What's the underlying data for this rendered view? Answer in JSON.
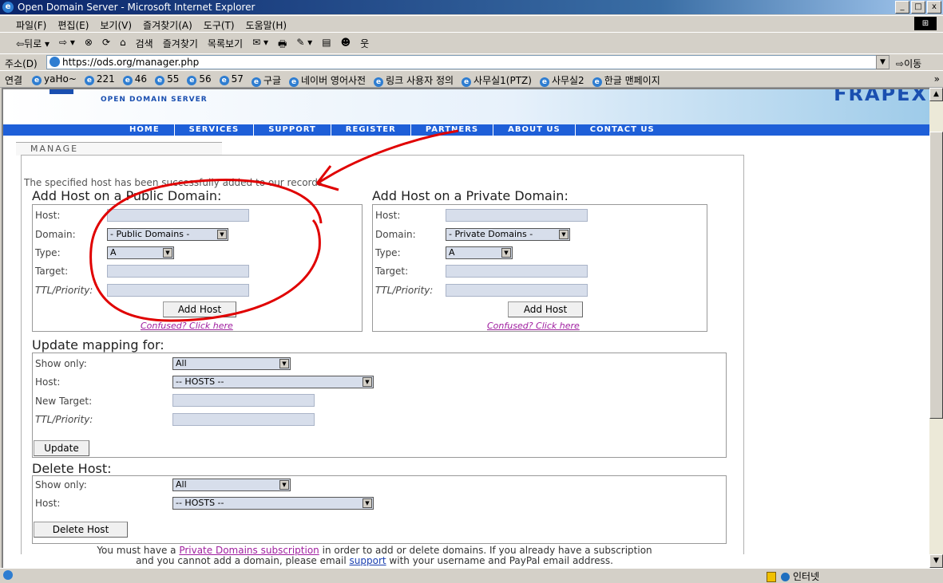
{
  "window": {
    "title": "Open Domain Server - Microsoft Internet Explorer",
    "buttons": [
      "_",
      "□",
      "x"
    ]
  },
  "menu": [
    "파일(F)",
    "편집(E)",
    "보기(V)",
    "즐겨찾기(A)",
    "도구(T)",
    "도움말(H)"
  ],
  "toolbar": [
    "⇦뒤로 ▾",
    "⇨ ▾",
    "⊗",
    "⟳",
    "⌂",
    "검색",
    "즐겨찾기",
    "목록보기",
    "✉ ▾",
    "🖶",
    "✎ ▾",
    "▤",
    "☻",
    "웃"
  ],
  "address": {
    "label": "주소(D)",
    "url": "https://ods.org/manager.php",
    "go": "이동"
  },
  "links": {
    "label": "연결",
    "items": [
      "yaHo~",
      "221",
      "46",
      "55",
      "56",
      "57",
      "구글",
      "네이버 영어사전",
      "링크 사용자 정의",
      "사무실1(PTZ)",
      "사무실2",
      "한글 맨페이지"
    ],
    "more": "»"
  },
  "site": {
    "logo": "OPEN DOMAIN SERVER",
    "brand": "FRAPEX",
    "nav": [
      "HOME",
      "SERVICES",
      "SUPPORT",
      "REGISTER",
      "PARTNERS",
      "ABOUT US",
      "CONTACT US"
    ],
    "manage_tab": "MANAGE",
    "message": "The specified host has been successfully added to our records"
  },
  "public_form": {
    "title": "Add Host on a Public Domain:",
    "host_label": "Host:",
    "domain_label": "Domain:",
    "domain_value": "- Public Domains -",
    "type_label": "Type:",
    "type_value": "A",
    "target_label": "Target:",
    "ttl_label": "TTL/Priority:",
    "button": "Add Host",
    "help": "Confused? Click here"
  },
  "private_form": {
    "title": "Add Host on a Private Domain:",
    "host_label": "Host:",
    "domain_label": "Domain:",
    "domain_value": "- Private Domains -",
    "type_label": "Type:",
    "type_value": "A",
    "target_label": "Target:",
    "ttl_label": "TTL/Priority:",
    "button": "Add Host",
    "help": "Confused? Click here"
  },
  "update_form": {
    "title": "Update mapping for:",
    "show_label": "Show only:",
    "show_value": "All",
    "host_label": "Host:",
    "host_value": "-- HOSTS --",
    "target_label": "New Target:",
    "ttl_label": "TTL/Priority:",
    "button": "Update"
  },
  "delete_form": {
    "title": "Delete Host:",
    "show_label": "Show only:",
    "show_value": "All",
    "host_label": "Host:",
    "host_value": "-- HOSTS --",
    "button": "Delete Host"
  },
  "footer": {
    "p1": "You must have a ",
    "link1": "Private Domains subscription",
    "p2": " in order to add or delete domains. If you already have a subscription",
    "p3": "and you cannot add a domain, please email ",
    "link2": "support",
    "p4": " with your username and PayPal email address."
  },
  "status": {
    "zone": "인터넷"
  },
  "colors": {
    "nav_bg": "#1e5fd8",
    "annotation": "#e00000",
    "link": "#a020a0"
  }
}
